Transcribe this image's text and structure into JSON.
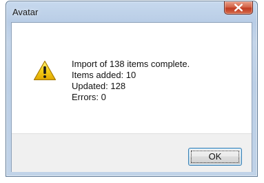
{
  "window": {
    "title": "Avatar",
    "close_icon": "close-x-icon"
  },
  "dialog": {
    "icon": "warning-icon",
    "message_lines": [
      "Import of 138 items complete.",
      "Items added: 10",
      "Updated: 128",
      "Errors: 0"
    ]
  },
  "buttons": {
    "ok_label": "OK"
  },
  "colors": {
    "warning_yellow": "#f2c500",
    "close_red": "#c8452b",
    "focus_border": "#3c7fb1"
  }
}
